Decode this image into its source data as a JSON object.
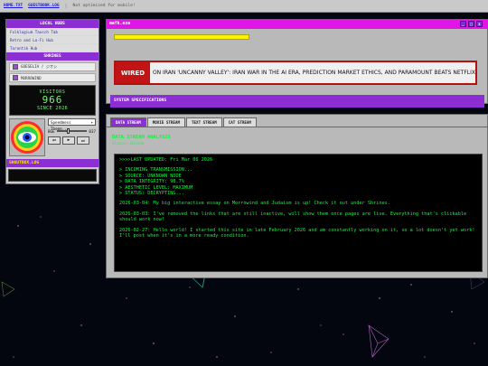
{
  "topbar": {
    "tab1": "HOME.TXT",
    "tab2": "GUESTBOOK.LOG",
    "separator": "|",
    "note": "Not optimized for mobile!"
  },
  "sidebar": {
    "local_hubs_title": "LOCAL HUBS",
    "local_hubs": [
      "Folklogium Tausch Tab",
      "Retro and Lo-Fi Hub",
      "Tarantik Hub"
    ],
    "shrines_title": "SHRINES",
    "shrines": [
      "GOESELIA / ジオシ",
      "MORROWIND"
    ],
    "counter": {
      "label": "VISITORS",
      "value": "966",
      "since": "SINCE 2026"
    },
    "player": {
      "track": "Speedmess Theme...",
      "vol_label": "BGE",
      "vol_value": "037",
      "prev": "⏮",
      "play": "▶",
      "next": "⏭"
    },
    "shoutbox_title": "SHOUTBOX.LOG"
  },
  "mainwin": {
    "title": "mafk.exe",
    "btn_min": "_",
    "btn_max": "□",
    "btn_close": "x",
    "ticker_label": "WIRED",
    "ticker_text": "ON IRAN      'UNCANNY VALLEY': IRAN WAR IN THE AI ERA, PREDICTION MARKET ETHICS, AND PARAMOUNT BEATS NETFLIX",
    "sysbar": "SYSTEM SPECIFICATIONS"
  },
  "datawin": {
    "tabs": [
      "DATA STREAM",
      "MOVIE STREAM",
      "TEXT STREAM",
      "CAT STREAM"
    ],
    "title": "DATA STREAM ANALYSIS",
    "subtitle": "Status: Online",
    "console": {
      "last_updated": ">>>>LAST UPDATED: Fri Mar 06 2026",
      "lines": [
        "> INCOMING TRANSMISSION...",
        "> SOURCE: UNKNOWN NODE",
        "> DATA INTEGRITY: 98.7%",
        "> AESTHETIC LEVEL: MAXIMUM",
        "> STATUS: DECRYPTING..."
      ],
      "posts": [
        "2026-03-04: My big interactive essay on Morrowind and Judaism is up! Check it out under Shrines.",
        "2026-03-03: I've removed the links that are still inactive, will show them once pages are live. Everything that's clickable should work now!",
        "2026-02-27: Hello world! I started this site in late February 2026 and am constantly working on it, so a lot doesn't yet work! I'll post when it's in a more ready condition."
      ]
    }
  },
  "colors": {
    "accent_purple": "#8b2ed3",
    "window_magenta": "#e016e6",
    "terminal_green": "#00ff33",
    "wired_red": "#c21414"
  }
}
